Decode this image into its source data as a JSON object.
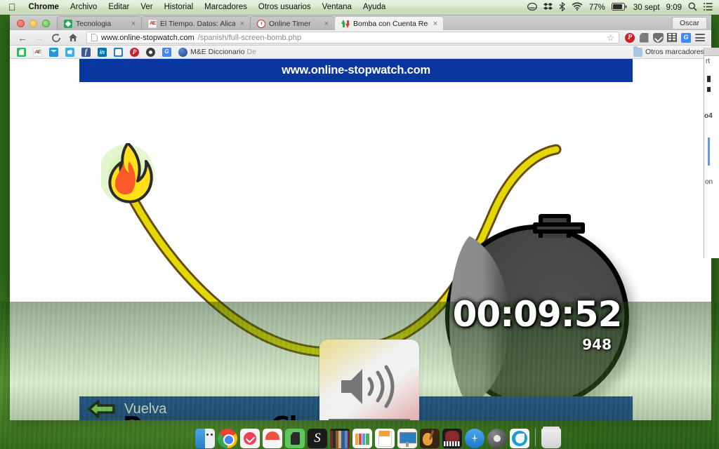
{
  "menubar": {
    "apple_icon": "apple-logo",
    "items": [
      "Chrome",
      "Archivo",
      "Editar",
      "Ver",
      "Historial",
      "Marcadores",
      "Otros usuarios",
      "Ventana",
      "Ayuda"
    ],
    "status": {
      "icons": [
        "timemachine-icon",
        "dropbox-icon",
        "bluetooth-icon",
        "wifi-icon"
      ],
      "battery_percent": "77%",
      "date": "30 sept",
      "time": "9:09",
      "search_icon": "spotlight-search-icon",
      "notification_icon": "notification-center-icon"
    }
  },
  "browser": {
    "window_controls": [
      "close",
      "minimize",
      "zoom"
    ],
    "profile_label": "Oscar",
    "tabs": [
      {
        "title": "Tecnologia",
        "favicon": "tecnologia-favicon",
        "active": false,
        "close_label": "×"
      },
      {
        "title": "El Tiempo. Datos: Alicante",
        "favicon": "eltiempo-favicon",
        "active": false,
        "close_label": "×"
      },
      {
        "title": "Online Timer",
        "favicon": "online-timer-favicon",
        "active": false,
        "close_label": "×"
      },
      {
        "title": "Bomba con Cuenta Regres",
        "favicon": "bomba-favicon",
        "active": true,
        "close_label": "×"
      }
    ],
    "toolbar": {
      "back_label": "←",
      "forward_label": "→",
      "reload_label": "C",
      "home_label": "⌂",
      "url_host": "www.online-stopwatch.com",
      "url_path": "/spanish/full-screen-bomb.php",
      "bookmark_star": "☆",
      "extensions": [
        "pinterest-icon",
        "evernote-icon",
        "pocket-icon",
        "film-icon",
        "google-translate-icon"
      ],
      "menu_icon": "chrome-menu-icon"
    },
    "bookmarks": [
      {
        "label": "",
        "icon": "evernote-bookmark-icon"
      },
      {
        "label": "",
        "icon": "ae-bookmark-icon"
      },
      {
        "label": "",
        "icon": "mail-bookmark-icon"
      },
      {
        "label": "",
        "icon": "twitter-bookmark-icon"
      },
      {
        "label": "",
        "icon": "facebook-bookmark-icon"
      },
      {
        "label": "",
        "icon": "linkedin-bookmark-icon"
      },
      {
        "label": "",
        "icon": "smiley-bookmark-icon"
      },
      {
        "label": "",
        "icon": "pinterest-bookmark-icon"
      },
      {
        "label": "",
        "icon": "gear-bookmark-icon"
      },
      {
        "label": "",
        "icon": "translate-bookmark-icon"
      }
    ],
    "bookmark_named": {
      "label": "M&E Diccionario",
      "suffix": "De",
      "icon": "globe-bookmark-icon"
    },
    "other_bookmarks": {
      "label": "Otros marcadores",
      "icon": "folder-icon"
    }
  },
  "page": {
    "banner_text": "www.online-stopwatch.com",
    "timer": {
      "main": "00:09:52",
      "milliseconds": "948"
    },
    "buttons": {
      "pause": "Pausa",
      "clear": "Clara"
    },
    "footer": {
      "back_icon": "back-arrow-icon",
      "back_label": "Vuelva"
    },
    "graphics": {
      "bomb": "bomb-icon",
      "fuse": "fuse-icon",
      "flame": "flame-icon"
    },
    "colors": {
      "banner_blue": "#0a36a0",
      "pause_blue": "#1976d2",
      "clear_red": "#b51f1f",
      "fuse_yellow": "#e3d800",
      "bomb_body": "#3d3d3d"
    }
  },
  "volume_osd": {
    "icon": "speaker-volume-icon",
    "segments_total": 16,
    "segments_filled": 11
  },
  "dock": {
    "items": [
      {
        "name": "finder",
        "running": true
      },
      {
        "name": "google-chrome",
        "running": true
      },
      {
        "name": "pocket",
        "running": true
      },
      {
        "name": "opera",
        "running": false
      },
      {
        "name": "evernote",
        "running": false
      },
      {
        "name": "scrivener",
        "running": true
      },
      {
        "name": "ibooks",
        "running": false
      },
      {
        "name": "numbers",
        "running": false
      },
      {
        "name": "pages",
        "running": false
      },
      {
        "name": "keynote",
        "running": false
      },
      {
        "name": "garageband",
        "running": false
      },
      {
        "name": "logic-pro",
        "running": false
      },
      {
        "name": "app-store",
        "running": false
      },
      {
        "name": "system-preferences",
        "running": false
      },
      {
        "name": "skitch",
        "running": false
      },
      {
        "name": "trash",
        "running": false
      }
    ]
  },
  "background_window": {
    "text_1": "rt",
    "text_2": "o4",
    "text_3": "on"
  }
}
